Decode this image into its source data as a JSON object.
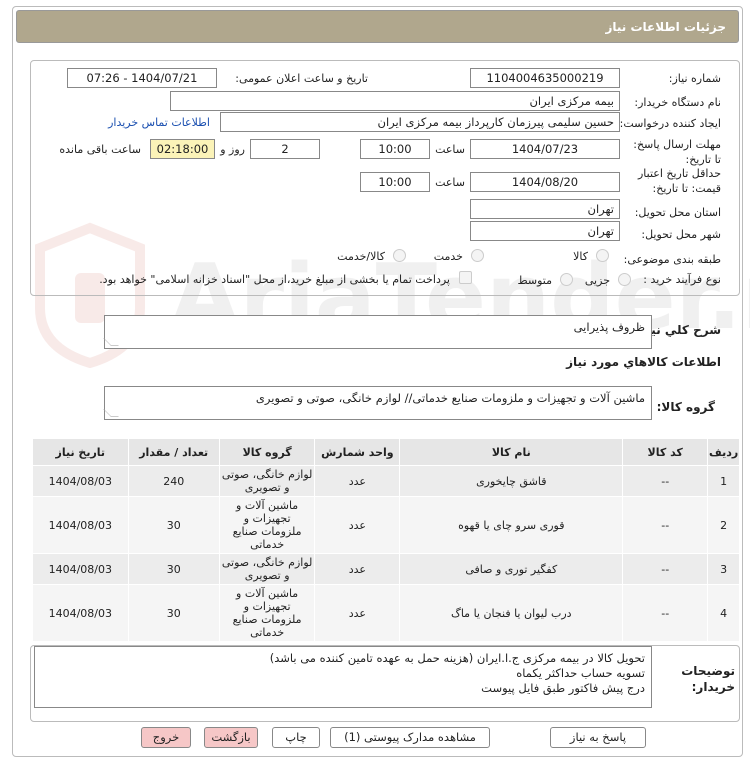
{
  "header": {
    "title": "جزئیات اطلاعات نیاز"
  },
  "form": {
    "need_number_label": "شماره نیاز:",
    "need_number": "1104004635000219",
    "announce_label": "تاریخ و ساعت اعلان عمومی:",
    "announce_value": "1404/07/21 - 07:26",
    "buyer_org_label": "نام دستگاه خریدار:",
    "buyer_org": "بیمه مرکزی ایران",
    "requester_label": "ایجاد کننده درخواست:",
    "requester": "حسین سلیمی پیرزمان کارپرداز بیمه مرکزی ایران",
    "contact_link": "اطلاعات تماس خریدار",
    "deadline_label": "مهلت ارسال پاسخ: تا تاریخ:",
    "deadline_date": "1404/07/23",
    "time_label": "ساعت",
    "deadline_time": "10:00",
    "days_value": "2",
    "days_label": "روز و",
    "remaining_value": "02:18:00",
    "remaining_label": "ساعت باقی مانده",
    "validity_label": "حداقل تاریخ اعتبار قیمت: تا تاریخ:",
    "validity_date": "1404/08/20",
    "validity_time": "10:00",
    "province_label": "استان محل تحویل:",
    "province": "تهران",
    "city_label": "شهر محل تحویل:",
    "city": "تهران",
    "category_label": "طبقه بندی موضوعی:",
    "category_options": [
      "کالا",
      "خدمت",
      "کالا/خدمت"
    ],
    "process_label": "نوع فرآیند خرید :",
    "process_options": [
      "جزیی",
      "متوسط"
    ],
    "payment_note": "پرداخت تمام یا بخشی از مبلغ خرید،از محل \"اسناد خزانه اسلامی\" خواهد بود."
  },
  "summary": {
    "label": "شرح کلي نياز:",
    "value": "ظروف پذیرایی"
  },
  "goods_info_title": "اطلاعات کالاهاي مورد نياز",
  "goods_group": {
    "label": "گروه کالا:",
    "value": "ماشین آلات و تجهیزات و ملزومات صنایع خدماتی// لوازم خانگی، صوتی و تصویری"
  },
  "table": {
    "headers": [
      "ردیف",
      "کد کالا",
      "نام کالا",
      "واحد شمارش",
      "گروه کالا",
      "تعداد / مقدار",
      "تاریخ نیاز"
    ],
    "rows": [
      [
        "1",
        "--",
        "قاشق چایخوری",
        "عدد",
        "لوازم خانگی، صوتی و تصویری",
        "240",
        "1404/08/03"
      ],
      [
        "2",
        "--",
        "قوری سرو چای یا قهوه",
        "عدد",
        "ماشین آلات و تجهیزات و ملزومات صنایع خدماتی",
        "30",
        "1404/08/03"
      ],
      [
        "3",
        "--",
        "کفگیر توری و صافی",
        "عدد",
        "لوازم خانگی، صوتی و تصویری",
        "30",
        "1404/08/03"
      ],
      [
        "4",
        "--",
        "درب لیوان یا فنجان یا ماگ",
        "عدد",
        "ماشین آلات و تجهیزات و ملزومات صنایع خدماتی",
        "30",
        "1404/08/03"
      ]
    ]
  },
  "buyer_notes": {
    "label": "توضیحات خریدار:",
    "lines": [
      "تحویل کالا در بیمه مرکزی ج.ا.ایران (هزینه حمل به عهده تامین کننده می باشد)",
      "تسویه حساب حداکثر یکماه",
      "درج پیش فاکتور طبق فایل پیوست"
    ]
  },
  "buttons": {
    "reply": "پاسخ به نیاز",
    "attachments": "مشاهده مدارک پیوستی (1)",
    "print": "چاپ",
    "back": "بازگشت",
    "exit": "خروج"
  },
  "watermark_text": "AriaTender.neT",
  "colors": {
    "title_bg": "#b0a78d",
    "yellow_field": "#fbf3b8",
    "pink_button": "#f6c7c7",
    "link": "#1a4fb0"
  }
}
